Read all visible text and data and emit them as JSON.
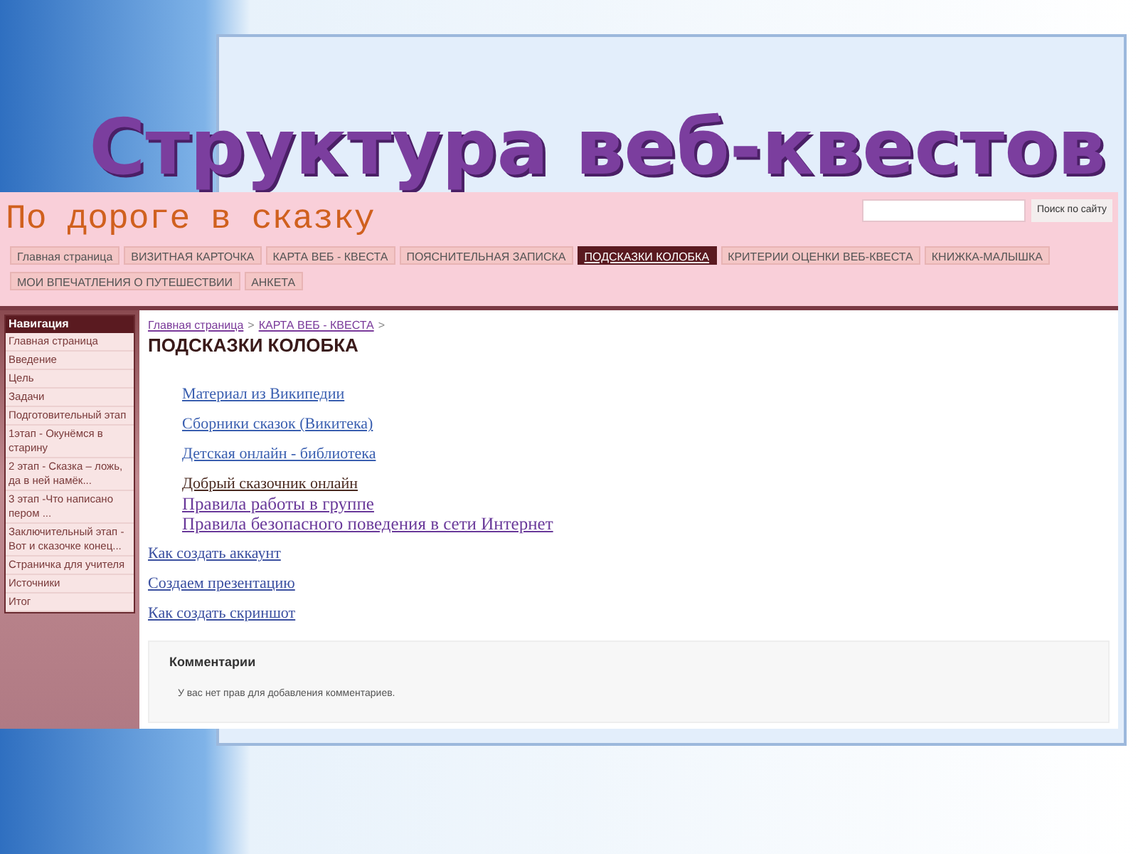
{
  "slide": {
    "title": "Структура веб-квестов"
  },
  "site": {
    "name": "По дороге в сказку",
    "search": {
      "button": "Поиск по сайту"
    },
    "tabs": [
      {
        "label": "Главная страница",
        "selected": false
      },
      {
        "label": "ВИЗИТНАЯ КАРТОЧКА",
        "selected": false
      },
      {
        "label": "КАРТА ВЕБ - КВЕСТА",
        "selected": false
      },
      {
        "label": "ПОЯСНИТЕЛЬНАЯ ЗАПИСКА",
        "selected": false
      },
      {
        "label": "ПОДСКАЗКИ КОЛОБКА",
        "selected": true
      },
      {
        "label": "КРИТЕРИИ ОЦЕНКИ ВЕБ-КВЕСТА",
        "selected": false
      },
      {
        "label": "КНИЖКА-МАЛЫШКА",
        "selected": false
      },
      {
        "label": "МОИ ВПЕЧАТЛЕНИЯ О ПУТЕШЕСТВИИ",
        "selected": false
      },
      {
        "label": "АНКЕТА",
        "selected": false
      }
    ],
    "sidebar": {
      "title": "Навигация",
      "items": [
        "Главная страница",
        "Введение",
        "Цель",
        "Задачи",
        "Подготовительный этап",
        "1этап - Окунёмся в старину",
        "2 этап - Сказка – ложь, да в ней намёк...",
        "3 этап -Что написано пером ...",
        "Заключительный этап - Вот и сказочке конец...",
        "Страничка для учителя",
        "Источники",
        "Итог"
      ]
    },
    "breadcrumbs": [
      "Главная страница",
      "КАРТА ВЕБ - КВЕСТА"
    ],
    "breadcrumb_separator": ">",
    "page_title": "ПОДСКАЗКИ КОЛОБКА",
    "links": [
      {
        "label": "Материал из Википедии",
        "kind": "indented"
      },
      {
        "label": "Сборники сказок (Викитека)",
        "kind": "indented"
      },
      {
        "label": "Детская онлайн - библиотека",
        "kind": "indented"
      },
      {
        "label": "Добрый сказочник онлайн",
        "kind": "dark"
      },
      {
        "label": "Правила работы в группе",
        "kind": "large"
      },
      {
        "label": "Правила безопасного поведения в сети Интернет",
        "kind": "large"
      },
      {
        "label": "Как создать аккаунт",
        "kind": "outer"
      },
      {
        "label": "Создаем презентацию",
        "kind": "outer"
      },
      {
        "label": "Как создать скриншот",
        "kind": "outer"
      }
    ],
    "comments": {
      "title": "Комментарии",
      "message": "У вас нет прав для добавления комментариев."
    }
  }
}
